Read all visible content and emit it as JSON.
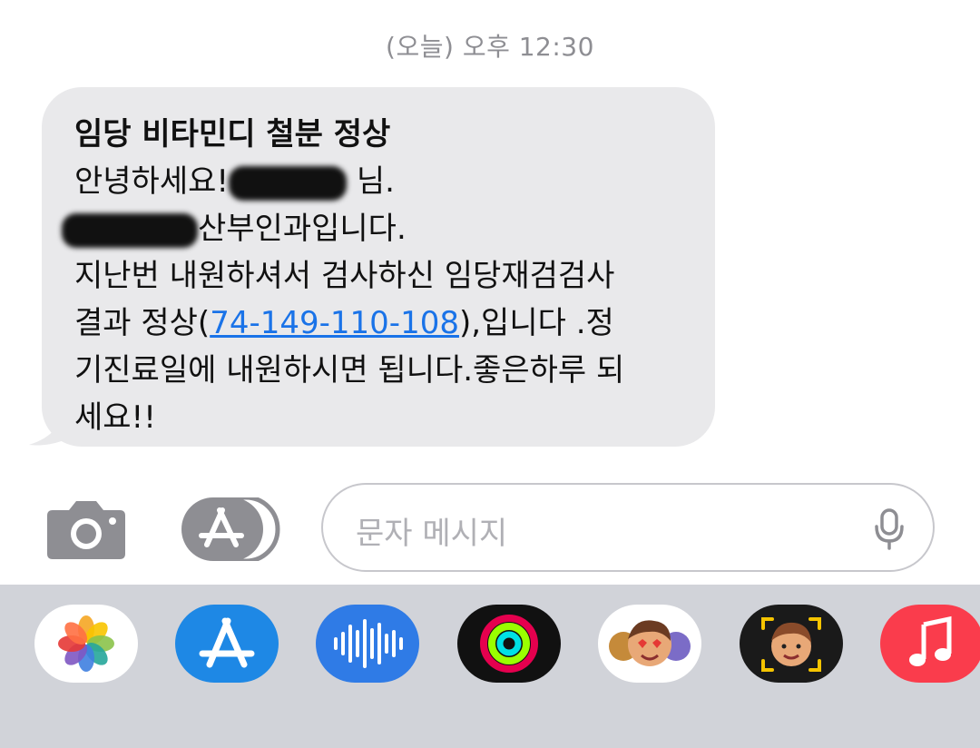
{
  "timestamp": "(오늘) 오후 12:30",
  "message": {
    "title": "임당 비타민디 철분 정상",
    "line1_prefix": "안녕하세요!",
    "line1_suffix": "님.",
    "line2_visible": "산부인과입니다.",
    "line3": "지난번 내원하셔서 검사하신 임당재검검사",
    "line4_before": "결과 정상(",
    "line4_link": "74-149-110-108",
    "line4_after": "),입니다 .정",
    "line5": "기진료일에 내원하시면 됩니다.좋은하루 되",
    "line6": "세요!!"
  },
  "composer": {
    "placeholder": "문자 메시지",
    "camera_icon": "camera-icon",
    "apps_icon": "app-store-icon",
    "mic_icon": "microphone-icon"
  },
  "app_drawer": {
    "apps": [
      "photos",
      "app-store",
      "audio-message",
      "activity",
      "memoji-stickers",
      "memoji",
      "music"
    ]
  },
  "colors": {
    "bubble": "#e9e9eb",
    "link": "#1a73e8",
    "drawer": "#d1d3d9"
  }
}
